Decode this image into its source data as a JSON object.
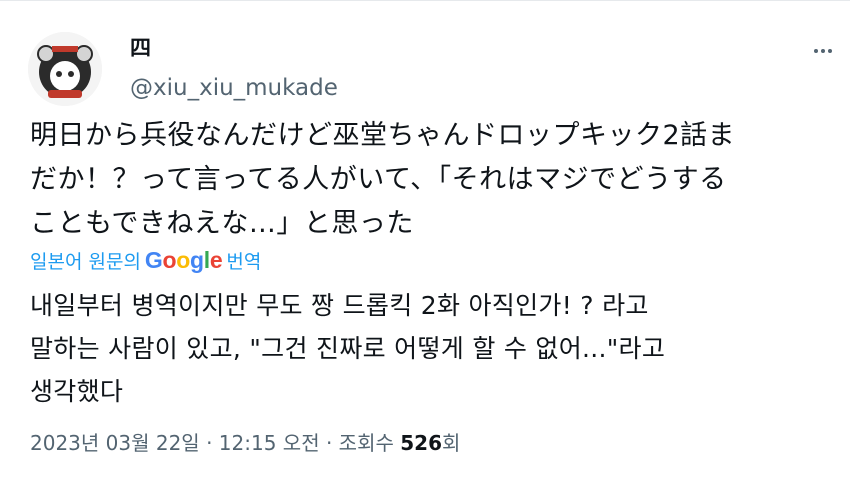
{
  "author": {
    "name": "四",
    "handle": "@xiu_xiu_mukade"
  },
  "tweet": {
    "original_lines": [
      "明日から兵役なんだけど巫堂ちゃんドロップキック2話ま",
      "だか！？って言ってる人がいて、「それはマジでどうする",
      "こともできねえな…」と思った"
    ],
    "translate_label_prefix": "일본어 원문의",
    "translate_google_parts": [
      "G",
      "o",
      "o",
      "g",
      "l",
      "e"
    ],
    "translate_label_suffix": "번역",
    "translated_lines": [
      "내일부터 병역이지만 무도 짱 드롭킥 2화 아직인가! ? 라고",
      "말하는 사람이 있고, \"그건 진짜로 어떻게 할 수 없어...\"라고",
      "생각했다"
    ]
  },
  "meta": {
    "date": "2023년 03월 22일",
    "sep1": "·",
    "time": "12:15 오전",
    "sep2": "·",
    "views_label": "조회수",
    "views_count": "526",
    "views_unit": "회"
  },
  "icons": {
    "avatar": "avatar-image",
    "more": "more-options-icon"
  },
  "colors": {
    "link": "#1d9bf0",
    "secondary_text": "#536471",
    "primary_text": "#0f1419"
  }
}
